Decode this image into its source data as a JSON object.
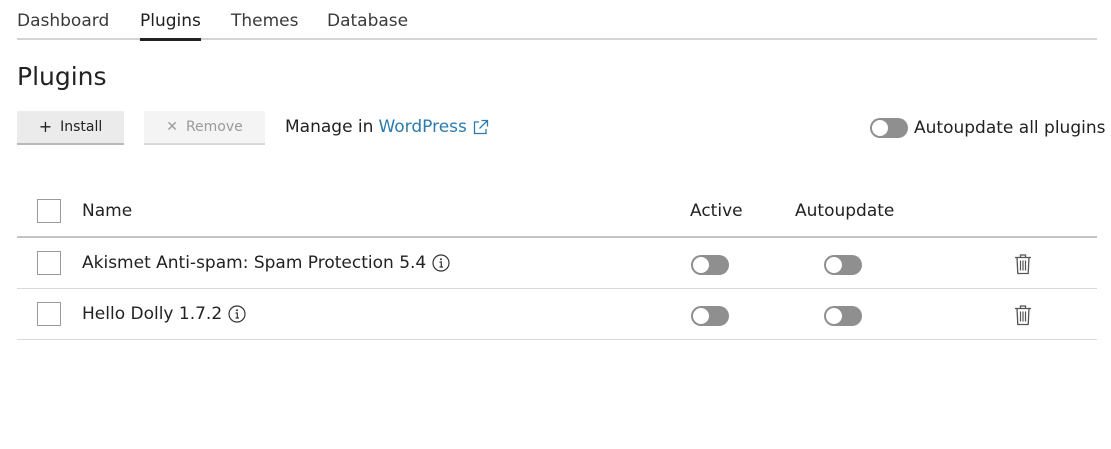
{
  "tabs": [
    {
      "label": "Dashboard",
      "active": false
    },
    {
      "label": "Plugins",
      "active": true
    },
    {
      "label": "Themes",
      "active": false
    },
    {
      "label": "Database",
      "active": false
    }
  ],
  "page": {
    "title": "Plugins"
  },
  "toolbar": {
    "install_label": "Install",
    "install_icon": "plus-icon",
    "remove_label": "Remove",
    "remove_icon": "close-icon",
    "manage_prefix": "Manage in",
    "manage_link": "WordPress",
    "manage_link_icon": "external-link-icon",
    "autoupdate_all_label": "Autoupdate all plugins",
    "autoupdate_all_on": false
  },
  "table": {
    "columns": {
      "name": "Name",
      "active": "Active",
      "autoupdate": "Autoupdate"
    },
    "rows": [
      {
        "name": "Akismet Anti-spam: Spam Protection 5.4",
        "active": false,
        "autoupdate": false
      },
      {
        "name": "Hello Dolly 1.7.2",
        "active": false,
        "autoupdate": false
      }
    ]
  },
  "colors": {
    "link": "#2b7cac",
    "toggle_off": "#8f8f8f",
    "active_tab_underline": "#222222"
  }
}
